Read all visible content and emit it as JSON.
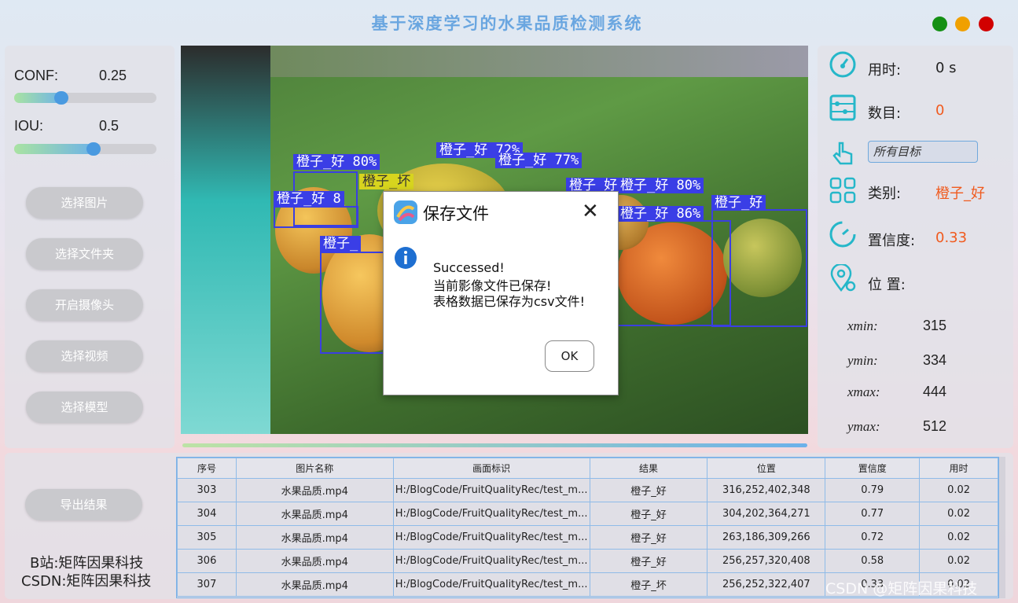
{
  "app_title": "基于深度学习的水果品质检测系统",
  "window_controls": [
    {
      "name": "maximize",
      "color": "#149014"
    },
    {
      "name": "minimize",
      "color": "#f0a000"
    },
    {
      "name": "close",
      "color": "#d10000"
    }
  ],
  "params": {
    "conf_label": "CONF:",
    "conf_value": "0.25",
    "conf_fraction": 0.25,
    "iou_label": "IOU:",
    "iou_value": "0.5",
    "iou_fraction": 0.5
  },
  "buttons": {
    "select_image": "选择图片",
    "select_folder": "选择文件夹",
    "open_camera": "开启摄像头",
    "select_video": "选择视频",
    "select_model": "选择模型",
    "export": "导出结果"
  },
  "detections": {
    "labels": [
      "橙子_好 72%",
      "橙子_好 80%",
      "橙子_好 77%",
      "橙子_坏",
      "橙子_好 79%",
      "橙子_好 80%",
      "橙子_好 8",
      "橙子_好 86%",
      "橙子_好",
      "橙子_"
    ]
  },
  "info": {
    "time_label": "用时:",
    "time_value": "0 s",
    "count_label": "数目:",
    "count_value": "0",
    "target_select": "所有目标",
    "class_label": "类别:",
    "class_value": "橙子_好",
    "conf_label": "置信度:",
    "conf_value": "0.33",
    "pos_label": "位 置:",
    "xmin_label": "xmin:",
    "xmin_value": "315",
    "ymin_label": "ymin:",
    "ymin_value": "334",
    "xmax_label": "xmax:",
    "xmax_value": "444",
    "ymax_label": "ymax:",
    "ymax_value": "512",
    "accent_color": "#f05a1e"
  },
  "table": {
    "headers": [
      "序号",
      "图片名称",
      "画面标识",
      "结果",
      "位置",
      "置信度",
      "用时"
    ],
    "rows": [
      [
        "303",
        "水果品质.mp4",
        "H:/BlogCode/FruitQualityRec/test_m...",
        "橙子_好",
        "316,252,402,348",
        "0.79",
        "0.02"
      ],
      [
        "304",
        "水果品质.mp4",
        "H:/BlogCode/FruitQualityRec/test_m...",
        "橙子_好",
        "304,202,364,271",
        "0.77",
        "0.02"
      ],
      [
        "305",
        "水果品质.mp4",
        "H:/BlogCode/FruitQualityRec/test_m...",
        "橙子_好",
        "263,186,309,266",
        "0.72",
        "0.02"
      ],
      [
        "306",
        "水果品质.mp4",
        "H:/BlogCode/FruitQualityRec/test_m...",
        "橙子_好",
        "256,257,320,408",
        "0.58",
        "0.02"
      ],
      [
        "307",
        "水果品质.mp4",
        "H:/BlogCode/FruitQualityRec/test_m...",
        "橙子_坏",
        "256,252,322,407",
        "0.33",
        "0.02"
      ]
    ]
  },
  "footer": {
    "bilibili": "B站:矩阵因果科技",
    "csdn": "CSDN:矩阵因果科技",
    "watermark": "CSDN @矩阵因果科技"
  },
  "dialog": {
    "title": "保存文件",
    "line1": "Successed!",
    "line2": "当前影像文件已保存!",
    "line3": "表格数据已保存为csv文件!",
    "ok": "OK"
  }
}
